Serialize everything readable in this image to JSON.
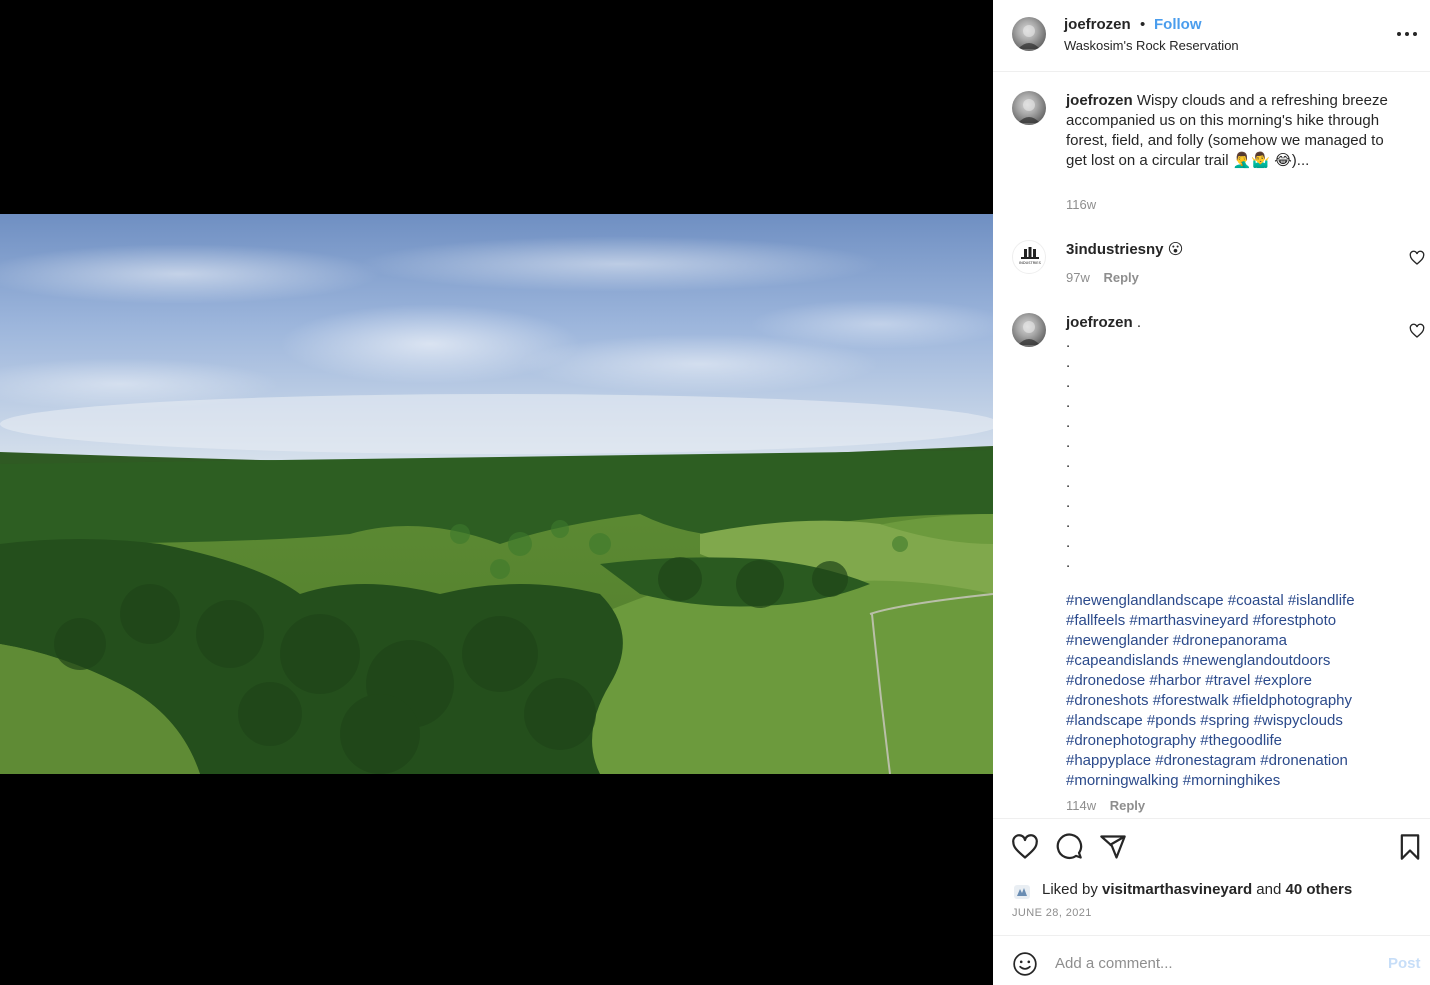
{
  "post": {
    "username": "joefrozen",
    "separator": "•",
    "follow_label": "Follow",
    "location": "Waskosim's Rock Reservation",
    "more_icon": "more-options-icon"
  },
  "caption": {
    "username": "joefrozen",
    "text": "Wispy clouds and a refreshing breeze accompanied us on this morning's hike through forest, field, and folly (somehow we managed to get lost on a circular trail 🤦‍♂️🤷‍♂️ 😂)...",
    "time": "116w"
  },
  "comments": [
    {
      "username": "3industriesny",
      "text": "😮",
      "time": "97w",
      "reply_label": "Reply",
      "avatar_text": "INDUSTRIES"
    },
    {
      "username": "joefrozen",
      "text": ".",
      "dots": [
        ".",
        ".",
        ".",
        ".",
        ".",
        ".",
        ".",
        ".",
        ".",
        ".",
        ".",
        "."
      ],
      "hashtags": [
        "#newenglandlandscape #coastal #islandlife",
        "#fallfeels #marthasvineyard #forestphoto",
        "#newenglander #dronepanorama",
        "#capeandislands #newenglandoutdoors",
        "#dronedose #harbor #travel #explore",
        "#droneshots #forestwalk #fieldphotography",
        "#landscape #ponds #spring #wispyclouds",
        "#dronephotography #thegoodlife",
        "#happyplace #dronestagram #dronenation",
        "#morningwalking #morninghikes"
      ],
      "time": "114w",
      "reply_label": "Reply"
    }
  ],
  "actions": {
    "like_icon": "heart-icon",
    "comment_icon": "comment-icon",
    "share_icon": "share-icon",
    "save_icon": "bookmark-icon"
  },
  "likes": {
    "prefix": "Liked by",
    "user": "visitmarthasvineyard",
    "and": "and",
    "others": "40 others"
  },
  "date": "JUNE 28, 2021",
  "add_comment": {
    "placeholder": "Add a comment...",
    "post_label": "Post"
  },
  "colors": {
    "follow": "#4a9ded",
    "hashtag": "#2b4a8b",
    "meta": "#8e8e8e",
    "post_disabled": "#c7def8"
  }
}
